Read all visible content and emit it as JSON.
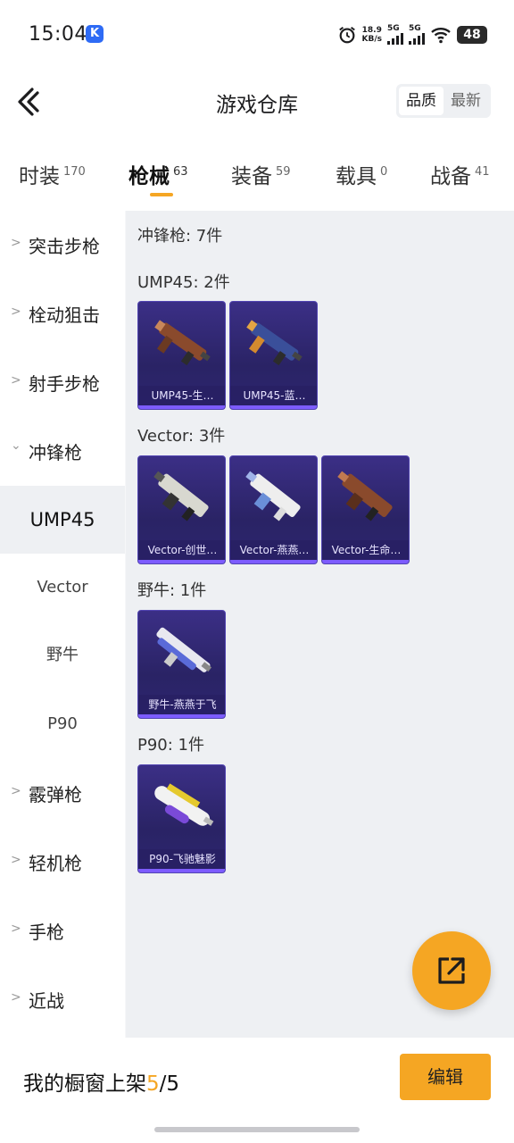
{
  "status_bar": {
    "time": "15:04",
    "app_badge": "K",
    "net_speed_value": "18.9",
    "net_speed_unit": "KB/s",
    "sim1": "5G",
    "sim2": "5G",
    "battery": "48"
  },
  "header": {
    "title": "游戏仓库",
    "sort_options": [
      "品质",
      "最新"
    ],
    "active_sort": "品质"
  },
  "tabs": [
    {
      "label": "时装",
      "count": "170"
    },
    {
      "label": "枪械",
      "count": "63"
    },
    {
      "label": "装备",
      "count": "59"
    },
    {
      "label": "载具",
      "count": "0"
    },
    {
      "label": "战备",
      "count": "41"
    }
  ],
  "active_tab": "枪械",
  "sidebar": {
    "categories": [
      {
        "label": "突击步枪"
      },
      {
        "label": "栓动狙击"
      },
      {
        "label": "射手步枪"
      },
      {
        "label": "冲锋枪",
        "expanded": true
      },
      {
        "label": "霰弹枪"
      },
      {
        "label": "轻机枪"
      },
      {
        "label": "手枪"
      },
      {
        "label": "近战"
      }
    ],
    "subcategories": [
      "UMP45",
      "Vector",
      "野牛",
      "P90"
    ],
    "active_subcategory": "UMP45"
  },
  "content": {
    "summary": "冲锋枪: 7件",
    "groups": [
      {
        "title": "UMP45: 2件",
        "items": [
          "UMP45-生…",
          "UMP45-蓝…"
        ]
      },
      {
        "title": "Vector: 3件",
        "items": [
          "Vector-创世…",
          "Vector-燕燕…",
          "Vector-生命…"
        ]
      },
      {
        "title": "野牛: 1件",
        "items": [
          "野牛-燕燕于飞"
        ]
      },
      {
        "title": "P90: 1件",
        "items": [
          "P90-飞驰魅影"
        ]
      }
    ]
  },
  "bottom_bar": {
    "shelf_label": "我的橱窗上架",
    "shelf_current": "5",
    "shelf_total": "/5",
    "edit_label": "编辑"
  },
  "colors": {
    "accent": "#f5a623",
    "card_bg": "#2a2365",
    "card_border": "#5245b2",
    "page_bg": "#eef0f3"
  }
}
